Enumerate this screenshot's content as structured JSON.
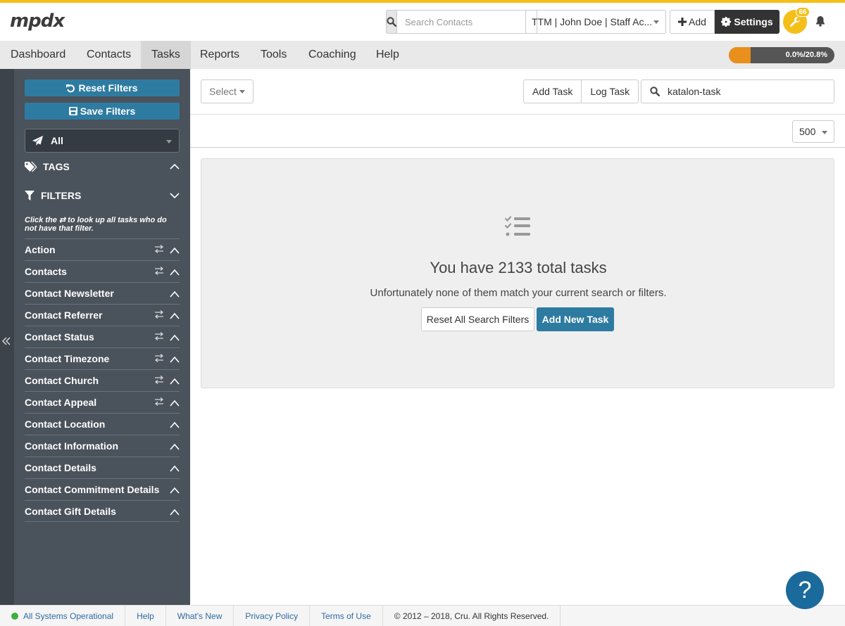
{
  "header": {
    "logo": "mpdx",
    "search_placeholder": "Search Contacts",
    "account": "TTM | John Doe | Staff Ac...",
    "add_label": "Add",
    "settings_label": "Settings",
    "badge_count": "66"
  },
  "nav": {
    "items": [
      "Dashboard",
      "Contacts",
      "Tasks",
      "Reports",
      "Tools",
      "Coaching",
      "Help"
    ],
    "active": "Tasks",
    "progress_label": "0.0%/20.8%",
    "progress_fraction": 0.208
  },
  "sidebar": {
    "reset_filters": "Reset Filters",
    "save_filters": "Save Filters",
    "select_value": "All",
    "tags_label": "TAGS",
    "filters_label": "FILTERS",
    "help_text": "Click the ⇄ to look up all tasks who do not have that filter.",
    "filters": [
      {
        "label": "Action",
        "swap": true
      },
      {
        "label": "Contacts",
        "swap": true
      },
      {
        "label": "Contact Newsletter",
        "swap": false
      },
      {
        "label": "Contact Referrer",
        "swap": true
      },
      {
        "label": "Contact Status",
        "swap": true
      },
      {
        "label": "Contact Timezone",
        "swap": true
      },
      {
        "label": "Contact Church",
        "swap": true
      },
      {
        "label": "Contact Appeal",
        "swap": true
      },
      {
        "label": "Contact Location",
        "swap": false
      },
      {
        "label": "Contact Information",
        "swap": false
      },
      {
        "label": "Contact Details",
        "swap": false
      },
      {
        "label": "Contact Commitment Details",
        "swap": false
      },
      {
        "label": "Contact Gift Details",
        "swap": false
      }
    ]
  },
  "toolbar": {
    "select_label": "Select",
    "add_task": "Add Task",
    "log_task": "Log Task",
    "search_value": "katalon-task",
    "per_page": "500"
  },
  "empty": {
    "title": "You have 2133 total tasks",
    "subtitle": "Unfortunately none of them match your current search or filters.",
    "reset_all": "Reset All Search Filters",
    "add_new": "Add New Task"
  },
  "footer": {
    "status": "All Systems Operational",
    "help": "Help",
    "whats_new": "What's New",
    "privacy": "Privacy Policy",
    "terms": "Terms of Use",
    "copyright": "© 2012 – 2018, Cru. All Rights Reserved."
  },
  "colors": {
    "accent": "#f5bf1a",
    "primary": "#2e7ba1",
    "sidebar": "#4a525b",
    "progress": "#e88f1c"
  }
}
